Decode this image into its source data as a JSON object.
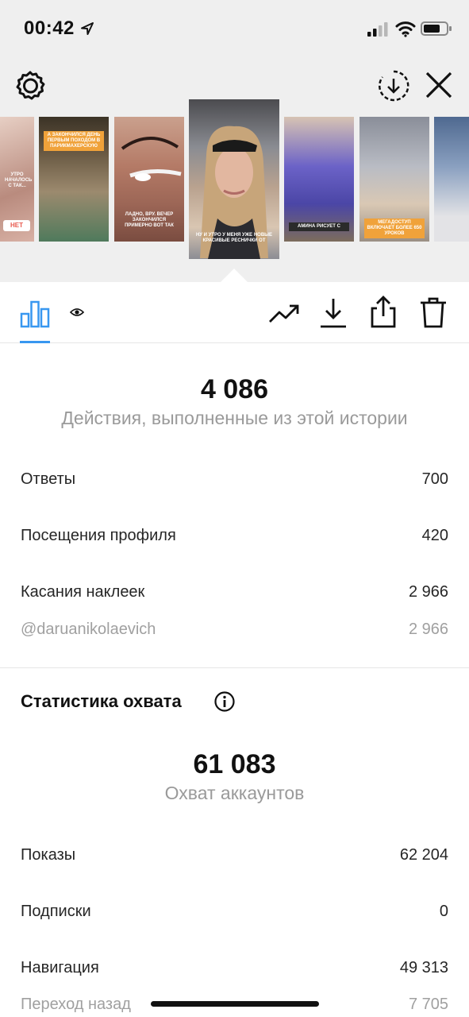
{
  "status_bar": {
    "time": "00:42"
  },
  "stories": [
    {
      "caption": "УТРО НАЧАЛОСЬ С ТАК...",
      "button": "НЕТ",
      "bg": "#c9a49a"
    },
    {
      "caption": "А ЗАКОНЧИЛСЯ ДЕНЬ ПЕРВЫМ ПОХОДОМ В ПАРИКМАХЕРСКУЮ",
      "bg": "#8d7a62"
    },
    {
      "caption": "ЛАДНО, ВРУ. ВЕЧЕР ЗАКОНЧИЛСЯ ПРИМЕРНО ВОТ ТАК",
      "bg": "#b77f6c"
    },
    {
      "caption": "НУ И УТРО У МЕНЯ УЖЕ НОВЫЕ КРАСИВЫЕ РЕСНИЧКИ ОТ",
      "bg": "#7c7e84"
    },
    {
      "caption": "АМИНА РИСУЕТ С",
      "bg": "#5b58a8"
    },
    {
      "caption": "МЕГАДОСТУП ВКЛЮЧАЕТ БОЛЕЕ 650 УРОКОВ",
      "bg": "#6a6f7a"
    },
    {
      "caption": "",
      "bg": "#5b6e8c"
    }
  ],
  "metrics": {
    "actions_value": "4 086",
    "actions_label": "Действия, выполненные из этой истории",
    "rows": [
      {
        "label": "Ответы",
        "value": "700"
      },
      {
        "label": "Посещения профиля",
        "value": "420"
      },
      {
        "label": "Касания наклеек",
        "value": "2 966"
      },
      {
        "label": "@daruanikolaevich",
        "value": "2 966"
      }
    ]
  },
  "reach": {
    "title": "Статистика охвата",
    "accounts_value": "61 083",
    "accounts_label": "Охват аккаунтов",
    "rows": [
      {
        "label": "Показы",
        "value": "62 204"
      },
      {
        "label": "Подписки",
        "value": "0"
      },
      {
        "label": "Навигация",
        "value": "49 313"
      },
      {
        "label": "Переход назад",
        "value": "7 705"
      }
    ]
  },
  "colors": {
    "accent": "#3897f0",
    "text": "#262626",
    "muted": "#9a9a9a",
    "top_bg": "#efefef"
  }
}
